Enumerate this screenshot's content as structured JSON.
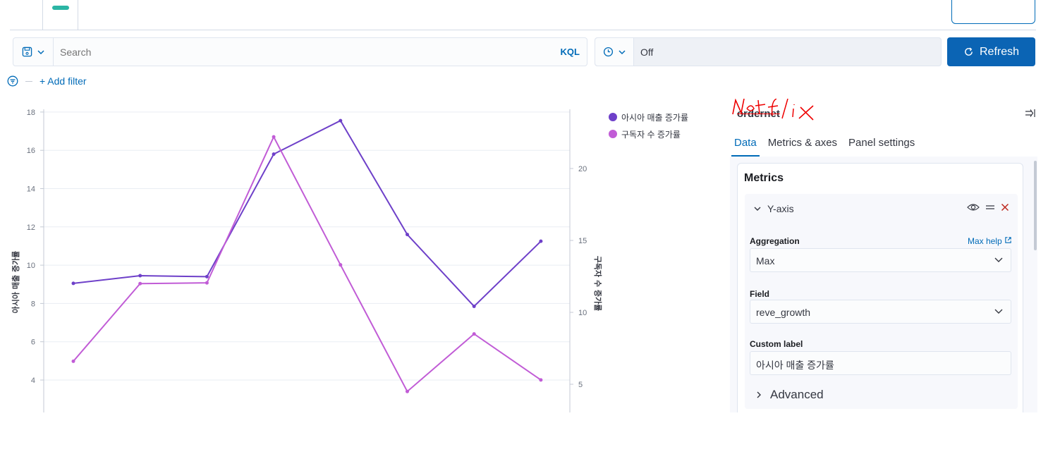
{
  "search": {
    "placeholder": "Search",
    "kql_label": "KQL"
  },
  "time": {
    "refresh_interval": "Off"
  },
  "refresh_label": "Refresh",
  "filter": {
    "add_label": "+ Add filter"
  },
  "panel": {
    "index_name": "ordernet",
    "annotation": "Netflix",
    "tabs": [
      {
        "label": "Data",
        "active": true
      },
      {
        "label": "Metrics & axes",
        "active": false
      },
      {
        "label": "Panel settings",
        "active": false
      }
    ],
    "metrics_title": "Metrics",
    "metric": {
      "label": "Y-axis",
      "aggregation_label": "Aggregation",
      "aggregation_help": "Max help",
      "aggregation_value": "Max",
      "field_label": "Field",
      "field_value": "reve_growth",
      "custom_label_label": "Custom label",
      "custom_label_value": "아시아 매출 증가률",
      "advanced_label": "Advanced"
    }
  },
  "colors": {
    "accent": "#006bb8",
    "refresh": "#0b64b4",
    "series1": "#6e40c9",
    "series2": "#c15cd6"
  },
  "chart_data": {
    "type": "line",
    "x": [
      1,
      2,
      3,
      4,
      5,
      6,
      7,
      8
    ],
    "series": [
      {
        "name": "아시아 매출 증가률",
        "axis": "left",
        "color": "#6e40c9",
        "values": [
          9.05,
          9.45,
          9.4,
          15.8,
          17.55,
          11.6,
          7.85,
          11.25
        ]
      },
      {
        "name": "구독자 수 증가률",
        "axis": "right",
        "color": "#c15cd6",
        "values": [
          6.6,
          12.0,
          12.05,
          22.2,
          13.3,
          4.5,
          8.5,
          5.3
        ]
      }
    ],
    "y_left": {
      "label": "아시아 매출 증가률",
      "ticks": [
        4,
        6,
        8,
        10,
        12,
        14,
        16,
        18
      ]
    },
    "y_right": {
      "label": "구독자 수 증가률",
      "ticks": [
        5,
        10,
        15,
        20
      ]
    },
    "grid": true,
    "legend": "top-right"
  }
}
